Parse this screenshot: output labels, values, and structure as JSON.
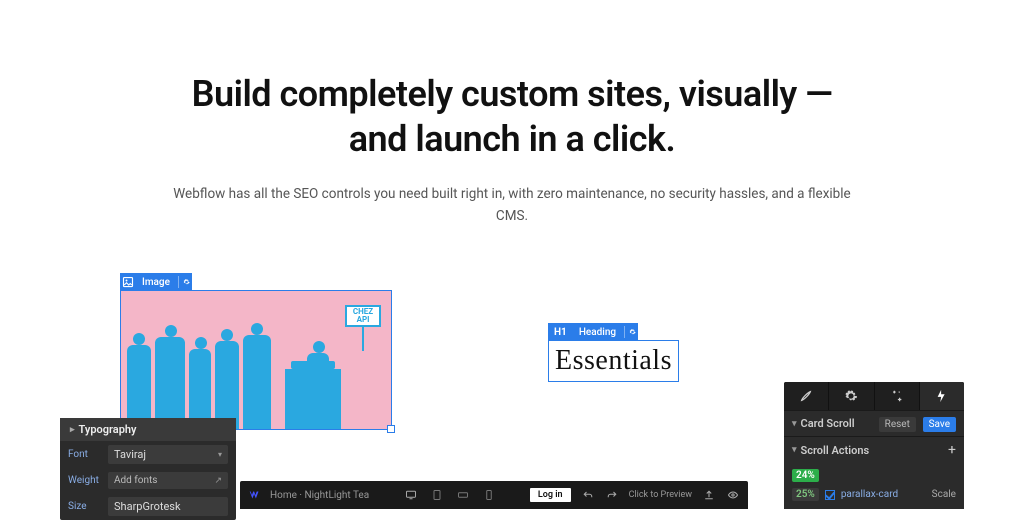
{
  "hero": {
    "title_l1": "Build completely custom sites, visually —",
    "title_l2": "and launch in a click.",
    "sub": "Webflow has all the SEO controls you need built right in, with zero maintenance, no security hassles, and a flexible CMS."
  },
  "image_card": {
    "tag_label": "Image",
    "sign_text": "CHEZ API"
  },
  "typography_panel": {
    "title": "Typography",
    "font_key": "Font",
    "font_value": "Taviraj",
    "weight_key": "Weight",
    "weight_value": "Add fonts",
    "size_key": "Size",
    "size_value": "SharpGrotesk"
  },
  "heading_card": {
    "tag_label": "Heading",
    "tag_prefix": "H1",
    "text": "Essentials"
  },
  "interactions_panel": {
    "card_scroll": "Card Scroll",
    "reset": "Reset",
    "save": "Save",
    "scroll_actions": "Scroll Actions",
    "pct1": "24%",
    "pct2": "25%",
    "item_name": "parallax-card",
    "scale": "Scale"
  },
  "designer_bar": {
    "title": "Home · NightLight Tea",
    "login": "Log in",
    "preview_hint": "Click to Preview"
  }
}
